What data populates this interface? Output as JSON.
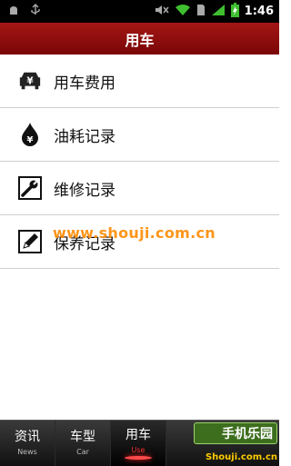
{
  "status_bar": {
    "time": "1:46",
    "icons": [
      "android-debug-icon",
      "usb-icon",
      "mute-icon",
      "wifi-icon",
      "sim-icon",
      "signal-icon",
      "battery-charging-icon"
    ]
  },
  "header": {
    "title": "用车"
  },
  "menu": {
    "items": [
      {
        "label": "用车费用",
        "icon": "car-fee-icon"
      },
      {
        "label": "油耗记录",
        "icon": "fuel-drop-icon"
      },
      {
        "label": "维修记录",
        "icon": "wrench-icon"
      },
      {
        "label": "保养记录",
        "icon": "pencil-icon"
      }
    ]
  },
  "watermark": {
    "text": "www.shouji.com.cn"
  },
  "tabs": [
    {
      "label": "资讯",
      "sub": "News",
      "active": false
    },
    {
      "label": "车型",
      "sub": "Car",
      "active": false
    },
    {
      "label": "用车",
      "sub": "Use",
      "active": true
    }
  ],
  "logo": {
    "title": "手机乐园",
    "url": "Shouji.com.cn"
  },
  "colors": {
    "header": "#8b0a0a",
    "watermark": "#ff8a00",
    "active_tab_accent": "#ff3030"
  }
}
